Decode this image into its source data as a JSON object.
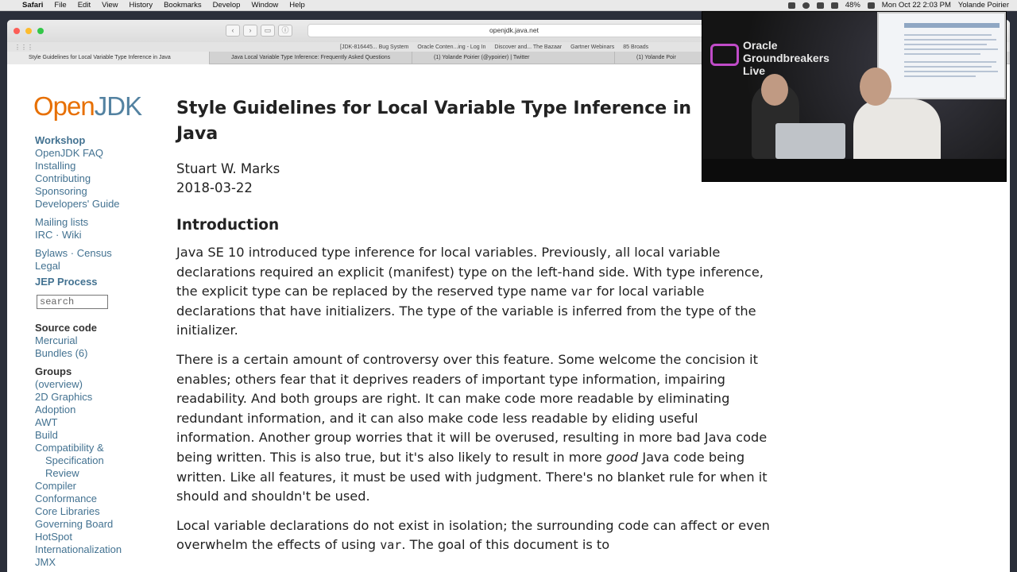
{
  "menubar": {
    "app": "Safari",
    "items": [
      "File",
      "Edit",
      "View",
      "History",
      "Bookmarks",
      "Develop",
      "Window",
      "Help"
    ],
    "battery": "48%",
    "clock": "Mon Oct 22  2:03 PM",
    "user": "Yolande Poirier"
  },
  "browser": {
    "address": "openjdk.java.net",
    "favorites": [
      "[JDK-816445... Bug System",
      "Oracle Conten...ing - Log In",
      "Discover and... The Bazaar",
      "Gartner Webinars",
      "85 Broads"
    ],
    "tabs": [
      "Style Guidelines for Local Variable Type Inference in Java",
      "Java Local Variable Type Inference: Frequently Asked Questions",
      "(1) Yolande Poirier (@ypoirier) | Twitter",
      "(1) Yolande Poir"
    ]
  },
  "logo": {
    "part1": "Open",
    "part2": "JDK"
  },
  "sidebar": {
    "workshop": "Workshop",
    "links1": [
      "OpenJDK FAQ",
      "Installing",
      "Contributing",
      "Sponsoring",
      "Developers' Guide"
    ],
    "links2": [
      "Mailing lists",
      "IRC · Wiki"
    ],
    "links3": [
      "Bylaws · Census",
      "Legal"
    ],
    "jep": "JEP Process",
    "search_placeholder": "search",
    "source_heading": "Source code",
    "source_links": [
      "Mercurial",
      "Bundles (6)"
    ],
    "groups_heading": "Groups",
    "group_links": [
      "(overview)",
      "2D Graphics",
      "Adoption",
      "AWT",
      "Build",
      "Compatibility &",
      "Specification",
      "Review",
      "Compiler",
      "Conformance",
      "Core Libraries",
      "Governing Board",
      "HotSpot",
      "Internationalization",
      "JMX"
    ]
  },
  "article": {
    "title_line1": "Style Guidelines for Local Variable Type Inference in",
    "title_line2": "Java",
    "author": "Stuart W. Marks",
    "date": "2018-03-22",
    "intro_heading": "Introduction",
    "p1_a": "Java SE 10 introduced type inference for local variables. Previously, all local variable declarations required an explicit (manifest) type on the left-hand side. With type inference, the explicit type can be replaced by the reserved type name",
    "p1_code": "var",
    "p1_b": "for local variable declarations that have initializers. The type of the variable is inferred from the type of the initializer.",
    "p2_a": "There is a certain amount of controversy over this feature. Some welcome the concision it enables; others fear that it deprives readers of important type information, impairing readability. And both groups are right. It can make code more readable by eliminating redundant information, and it can also make code less readable by eliding useful information. Another group worries that it will be overused, resulting in more bad Java code being written. This is also true, but it's also likely to result in more",
    "p2_em": "good",
    "p2_b": "Java code being written. Like all features, it must be used with judgment. There's no blanket rule for when it should and shouldn't be used.",
    "p3_a": "Local variable declarations do not exist in isolation; the surrounding code can affect or even overwhelm the effects of using",
    "p3_code": "var",
    "p3_b": ". The goal of this document is to"
  },
  "video": {
    "brand_line1": "Oracle",
    "brand_line2": "Groundbreakers",
    "brand_line3": "Live"
  }
}
